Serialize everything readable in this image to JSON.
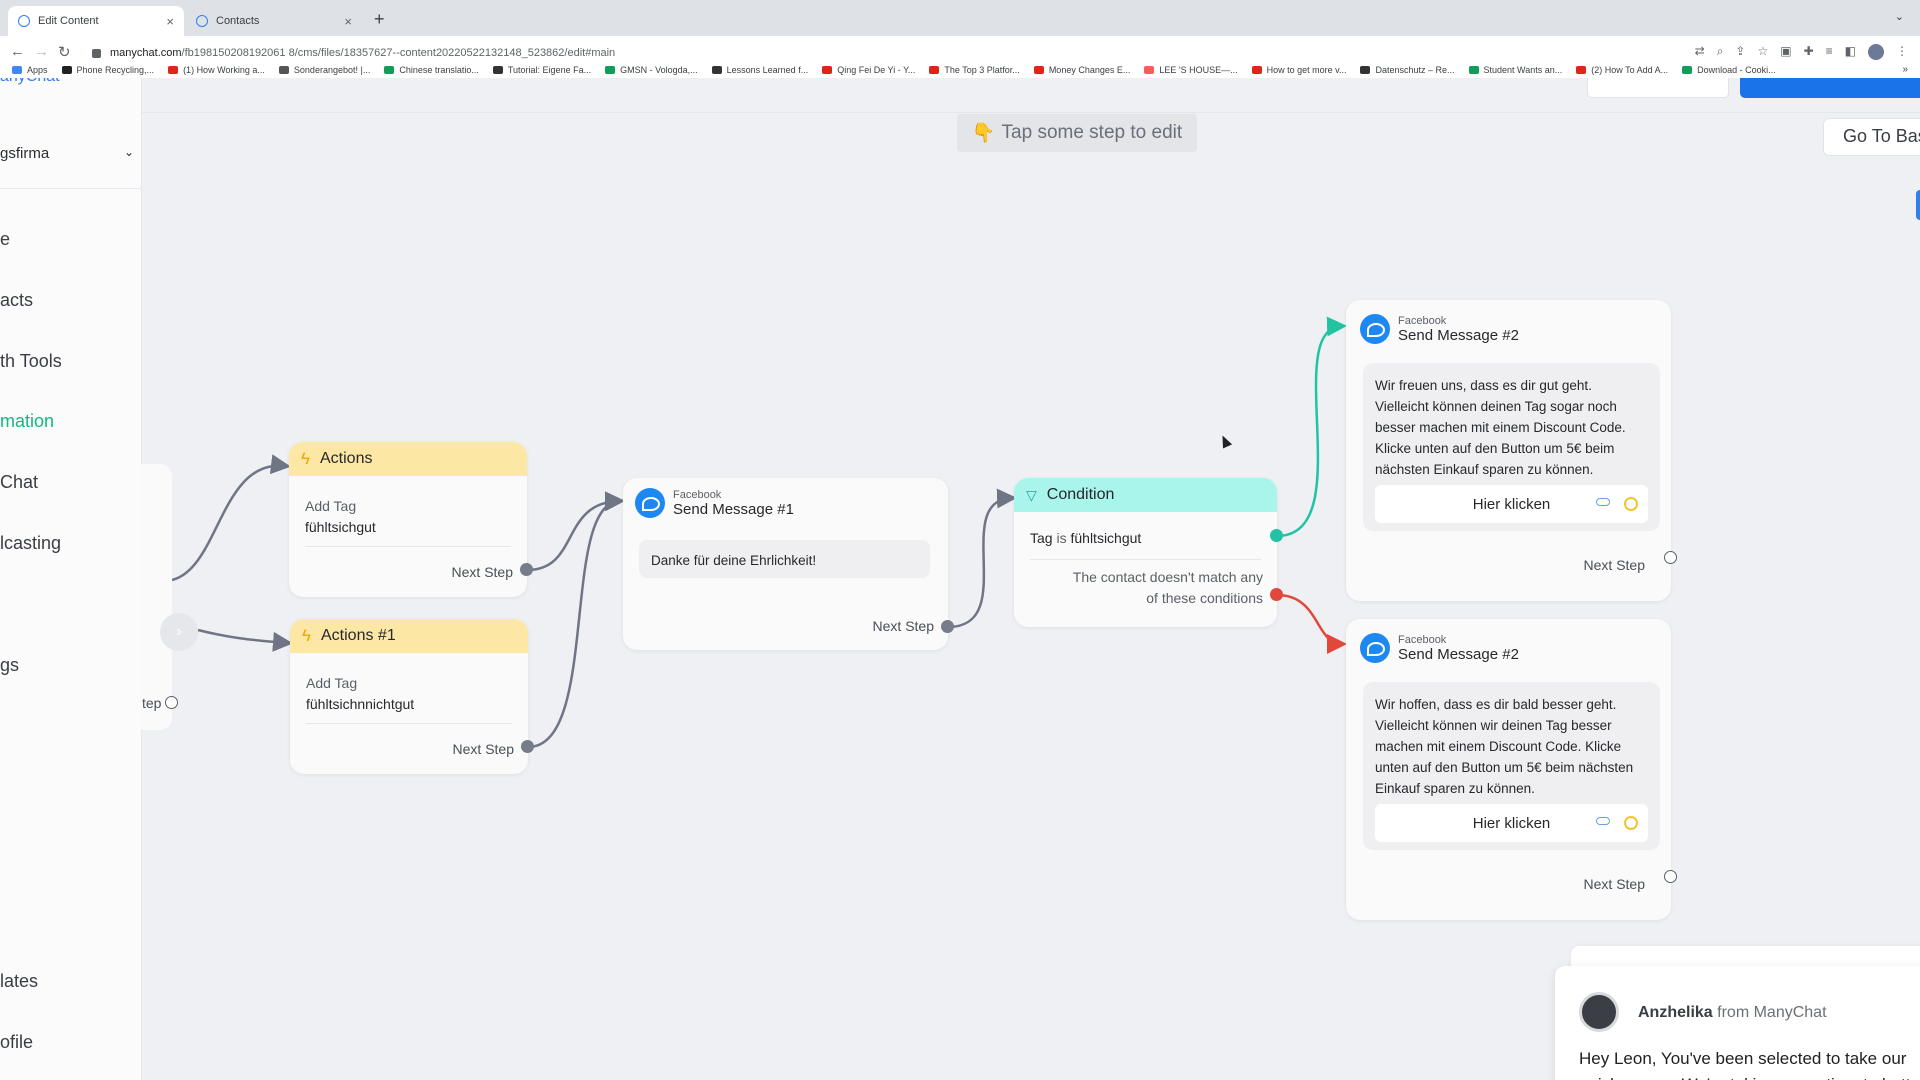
{
  "browser": {
    "tabs": [
      {
        "label": "Edit Content",
        "active": true
      },
      {
        "label": "Contacts",
        "active": false
      }
    ],
    "new_tab": "+",
    "url_host": "manychat.com",
    "url_path": "/fb198150208192061 8/cms/files/18357627--content20220522132148_523862/edit#main",
    "bookmarks": [
      {
        "label": "Apps",
        "color": "#4285f4"
      },
      {
        "label": "Phone Recycling,...",
        "color": "#202124"
      },
      {
        "label": "(1) How Working a...",
        "color": "#e62117"
      },
      {
        "label": "Sonderangebot! |...",
        "color": "#555555"
      },
      {
        "label": "Chinese translatio...",
        "color": "#0f9d58"
      },
      {
        "label": "Tutorial: Eigene Fa...",
        "color": "#333333"
      },
      {
        "label": "GMSN - Vologda,...",
        "color": "#0f9d58"
      },
      {
        "label": "Lessons Learned f...",
        "color": "#333333"
      },
      {
        "label": "Qing Fei De Yi - Y...",
        "color": "#e62117"
      },
      {
        "label": "The Top 3 Platfor...",
        "color": "#e62117"
      },
      {
        "label": "Money Changes E...",
        "color": "#e62117"
      },
      {
        "label": "LEE 'S HOUSE—...",
        "color": "#ff5a5f"
      },
      {
        "label": "How to get more v...",
        "color": "#e62117"
      },
      {
        "label": "Datenschutz – Re...",
        "color": "#333333"
      },
      {
        "label": "Student Wants an...",
        "color": "#0f9d58"
      },
      {
        "label": "(2) How To Add A...",
        "color": "#e62117"
      },
      {
        "label": "Download - Cooki...",
        "color": "#0f9d58"
      }
    ],
    "bookmarks_more": "»"
  },
  "sidebar": {
    "logo": "anyChat",
    "account": "gsfirma",
    "items": [
      {
        "label": "e",
        "active": false
      },
      {
        "label": "acts",
        "active": false
      },
      {
        "label": "th Tools",
        "active": false
      },
      {
        "label": "mation",
        "active": true
      },
      {
        "label": "Chat",
        "active": false
      },
      {
        "label": "lcasting",
        "active": false
      },
      {
        "label": "gs",
        "active": false
      },
      {
        "label": "lates",
        "active": false
      },
      {
        "label": "ofile",
        "active": false
      }
    ]
  },
  "canvas": {
    "hint": "Tap some step to edit",
    "go_to_basic": "Go To Bas",
    "stub_next": "tep",
    "actions": {
      "title": "Actions",
      "action_label": "Add Tag",
      "action_value": "fühltsichgut",
      "next": "Next Step"
    },
    "actions1": {
      "title": "Actions #1",
      "action_label": "Add Tag",
      "action_value": "fühltsichnnichtgut",
      "next": "Next Step"
    },
    "send1": {
      "platform": "Facebook",
      "title": "Send Message #1",
      "message": "Danke für deine Ehrlichkeit!",
      "next": "Next Step"
    },
    "condition": {
      "title": "Condition",
      "tag_word": "Tag",
      "is_word": "is",
      "tag_value": "fühltsichgut",
      "no_match_line1": "The contact doesn't match any",
      "no_match_line2": "of these conditions"
    },
    "send2a": {
      "platform": "Facebook",
      "title": "Send Message #2",
      "lines": [
        "Wir freuen uns, dass es dir gut geht.",
        "Vielleicht können deinen Tag sogar noch",
        "besser machen mit einem Discount Code.",
        "Klicke unten auf den Button um 5€ beim",
        "nächsten Einkauf sparen zu können."
      ],
      "button": "Hier klicken",
      "next": "Next Step"
    },
    "send2b": {
      "platform": "Facebook",
      "title": "Send Message #2",
      "lines": [
        "Wir hoffen, dass es dir bald besser geht.",
        "Vielleicht können wir deinen Tag besser",
        "machen mit einem Discount Code. Klicke",
        "unten auf den Button um 5€ beim nächsten",
        "Einkauf sparen zu können."
      ],
      "button": "Hier klicken",
      "next": "Next Step"
    },
    "colors": {
      "wire": "#6f7584",
      "true_branch": "#21c3a3",
      "false_branch": "#e1483b",
      "active_nav": "#11b981"
    }
  },
  "chat": {
    "sender_name": "Anzhelika",
    "sender_suffix": "from ManyChat",
    "line1": "Hey Leon,  You've been selected to take our",
    "line2": "quick survey. We're taking some time to bette"
  }
}
